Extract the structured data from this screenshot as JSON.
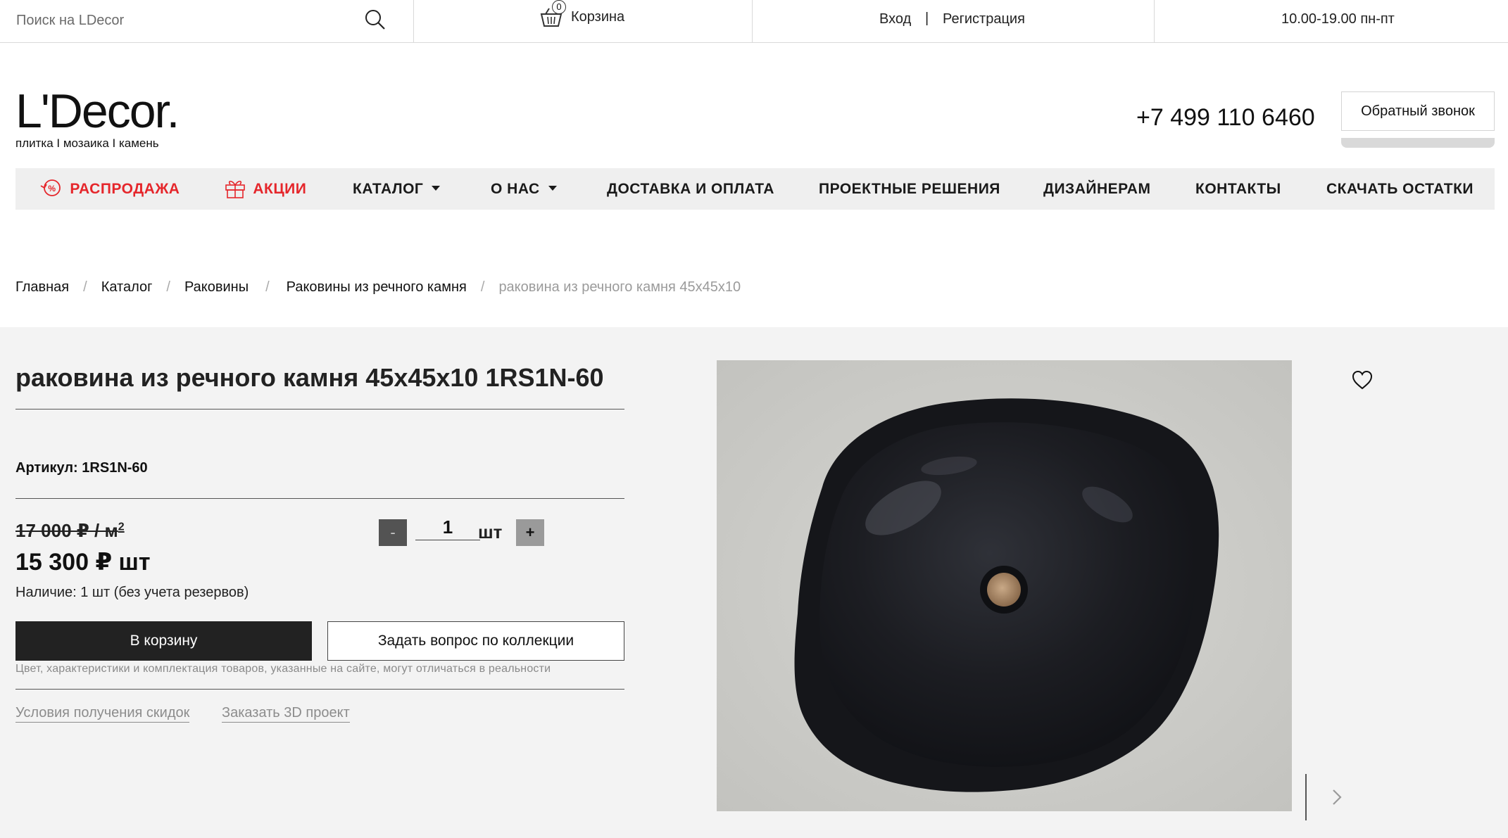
{
  "topbar": {
    "search_placeholder": "Поиск на LDecor",
    "cart_count": "0",
    "cart_label": "Корзина",
    "login": "Вход",
    "separator": "|",
    "register": "Регистрация",
    "hours": "10.00-19.00 пн-пт"
  },
  "header": {
    "logo_text": "L'Decor.",
    "tagline": "плитка І мозаика І камень",
    "phone": "+7 499 110 6460",
    "callback_button": "Обратный звонок"
  },
  "nav": {
    "items": [
      {
        "label": "РАСПРОДАЖА",
        "icon": "percent-icon"
      },
      {
        "label": "АКЦИИ",
        "icon": "gift-icon"
      },
      {
        "label": "КАТАЛОГ",
        "icon": "chevron-down-icon"
      },
      {
        "label": "О НАС",
        "icon": "chevron-down-icon"
      },
      {
        "label": "ДОСТАВКА И ОПЛАТА"
      },
      {
        "label": "ПРОЕКТНЫЕ РЕШЕНИЯ"
      },
      {
        "label": "ДИЗАЙНЕРАМ"
      },
      {
        "label": "КОНТАКТЫ"
      },
      {
        "label": "СКАЧАТЬ ОСТАТКИ"
      }
    ],
    "accent_color": "#e5262b"
  },
  "breadcrumb": {
    "items": [
      "Главная",
      "Каталог",
      "Раковины",
      "Раковины из речного камня"
    ],
    "separator": "/",
    "current": "раковина из речного камня 45x45x10"
  },
  "product": {
    "title": "раковина из речного камня 45x45x10 1RS1N-60",
    "sku_label": "Артикул:",
    "sku": "1RS1N-60",
    "old_price": "17 000 ₽ / м",
    "old_price_sup": "2",
    "new_price": "15 300 ₽ шт",
    "stock": "Наличие: 1 шт (без учета резервов)",
    "quantity": "1",
    "qty_unit": "шт",
    "qty_minus": "-",
    "qty_plus": "+",
    "add_to_cart": "В корзину",
    "ask_question": "Задать вопрос по коллекции",
    "disclaimer": "Цвет, характеристики и комплектация товаров, указанные на сайте, могут отличаться в реальности",
    "link_discounts": "Условия получения скидок",
    "link_3d": "Заказать 3D проект"
  }
}
